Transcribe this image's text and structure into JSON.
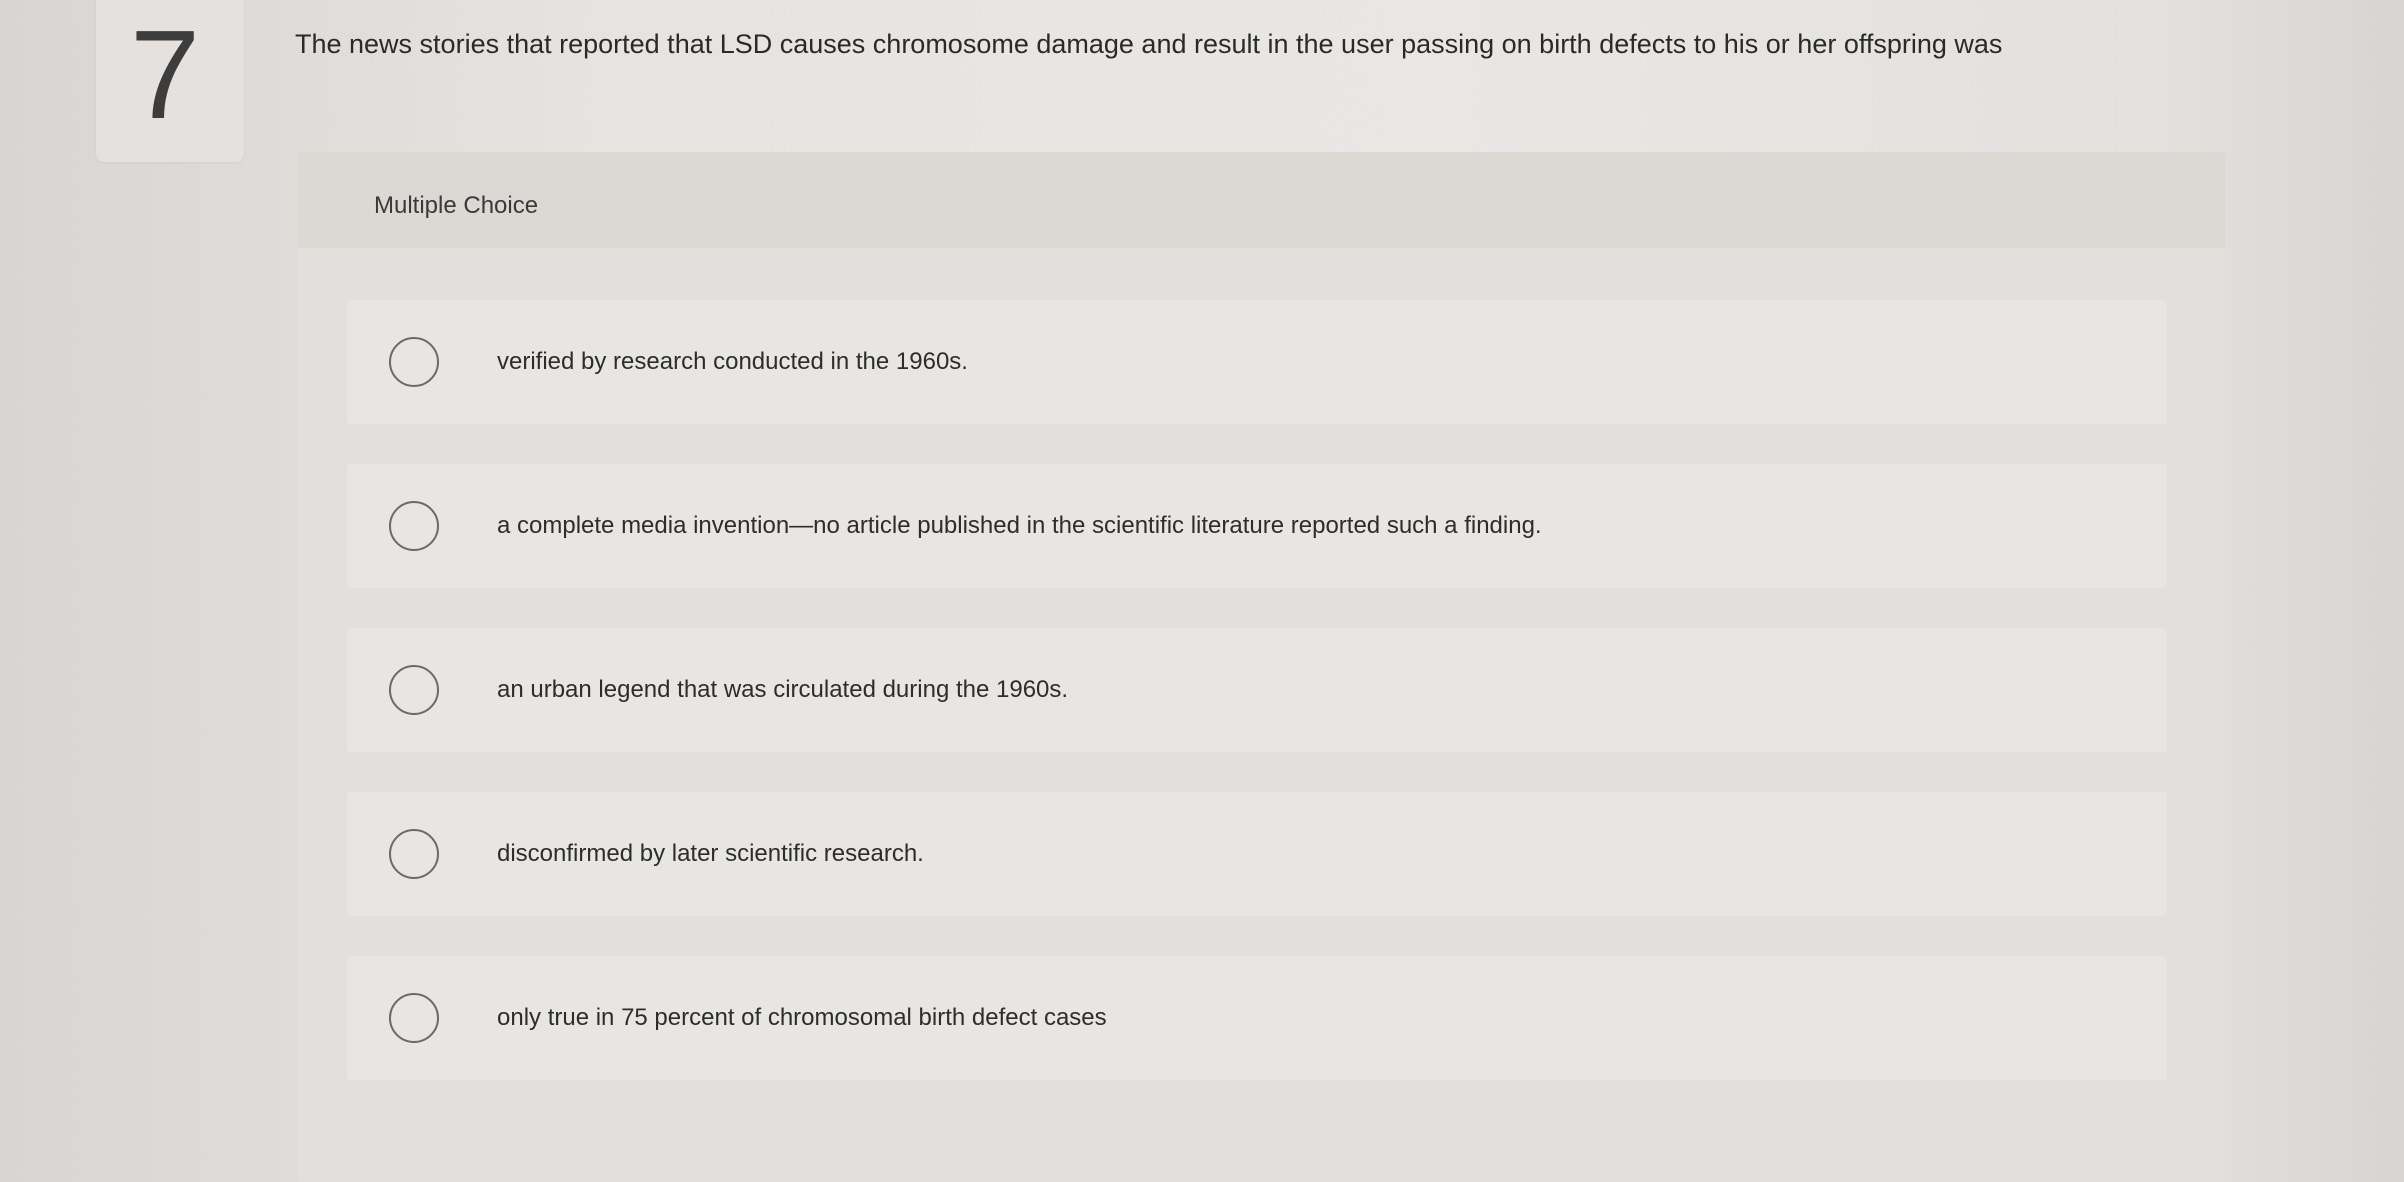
{
  "question": {
    "number": "7",
    "text": "The news stories that reported that LSD causes chromosome damage and result in the user passing on birth defects to his or her offspring was"
  },
  "multiple_choice": {
    "label": "Multiple Choice",
    "options": [
      {
        "text": "verified by research conducted in the 1960s."
      },
      {
        "text": "a complete media invention—no article published in the scientific literature reported such a finding."
      },
      {
        "text": "an urban legend that was circulated during the 1960s."
      },
      {
        "text": "disconfirmed by later scientific research."
      },
      {
        "text": "only true in 75 percent of chromosomal birth defect cases"
      }
    ]
  }
}
